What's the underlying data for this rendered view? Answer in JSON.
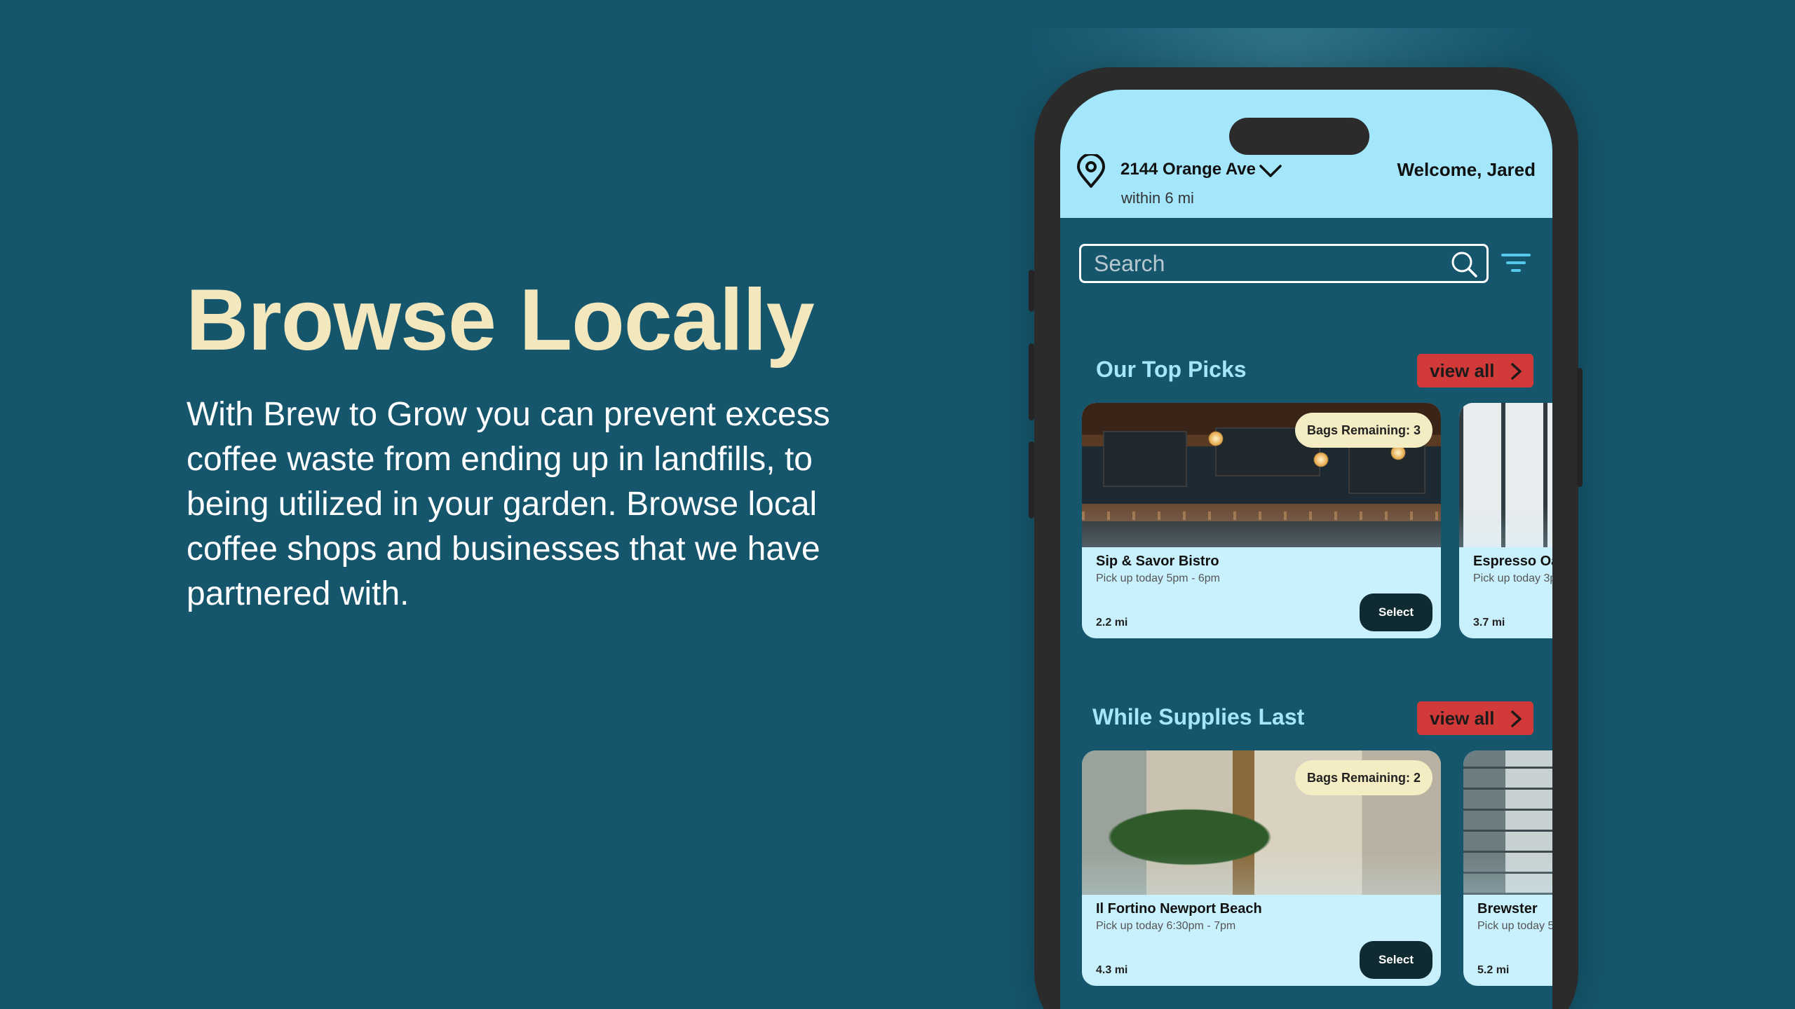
{
  "hero": {
    "title": "Browse Locally",
    "body": "With Brew to Grow you can prevent excess coffee waste from ending up in landfills, to being utilized in your garden. Browse local coffee shops and businesses that we have partnered with."
  },
  "app": {
    "header": {
      "address": "2144 Orange Ave",
      "radius": "within 6 mi",
      "welcome": "Welcome, Jared"
    },
    "search": {
      "placeholder": "Search"
    },
    "sections": [
      {
        "title": "Our Top Picks",
        "view_all": "view all",
        "cards": [
          {
            "name": "Sip & Savor Bistro",
            "pickup": "Pick up today 5pm - 6pm",
            "distance": "2.2 mi",
            "bags": "Bags Remaining: 3",
            "select": "Select"
          },
          {
            "name": "Espresso Oas",
            "pickup": "Pick up today 3p",
            "distance": "3.7 mi"
          }
        ]
      },
      {
        "title": "While Supplies Last",
        "view_all": "view all",
        "cards": [
          {
            "name": "Il Fortino Newport Beach",
            "pickup": "Pick up today 6:30pm - 7pm",
            "distance": "4.3 mi",
            "bags": "Bags Remaining: 2",
            "select": "Select"
          },
          {
            "name": "Brewster",
            "pickup": "Pick up today 5",
            "distance": "5.2 mi"
          }
        ]
      }
    ],
    "icons": [
      "location-pin-icon",
      "chevron-down-icon",
      "search-icon",
      "filter-icon",
      "arrow-right-icon"
    ],
    "colors": {
      "background": "#16566d",
      "header": "#a4e6fb",
      "card": "#c9f1fd",
      "accent_red": "#d23a3a",
      "hero_title": "#f3e7bd",
      "select_button": "#0f2a30",
      "badge": "#f4ecc2"
    }
  }
}
